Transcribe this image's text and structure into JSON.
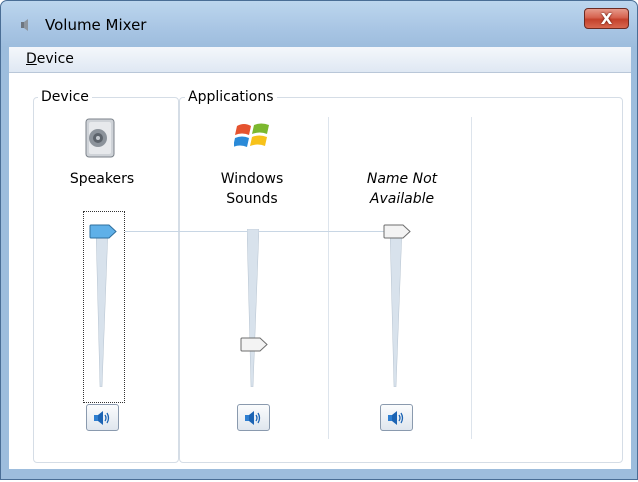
{
  "window": {
    "title": "Volume Mixer",
    "close_label": "X"
  },
  "menu": {
    "device_label_u": "D",
    "device_label_rest": "evice"
  },
  "device_group": {
    "title": "Device",
    "name": "Speakers",
    "level": 1.0
  },
  "applications_group": {
    "title": "Applications",
    "apps": [
      {
        "name_line1": "Windows",
        "name_line2": "Sounds",
        "italic": false,
        "level": 0.25
      },
      {
        "name_line1": "Name Not",
        "name_line2": "Available",
        "italic": true,
        "level": 1.0
      }
    ]
  },
  "colors": {
    "accent_thumb": "#5fb0e8",
    "track": "#d8e2ec"
  }
}
